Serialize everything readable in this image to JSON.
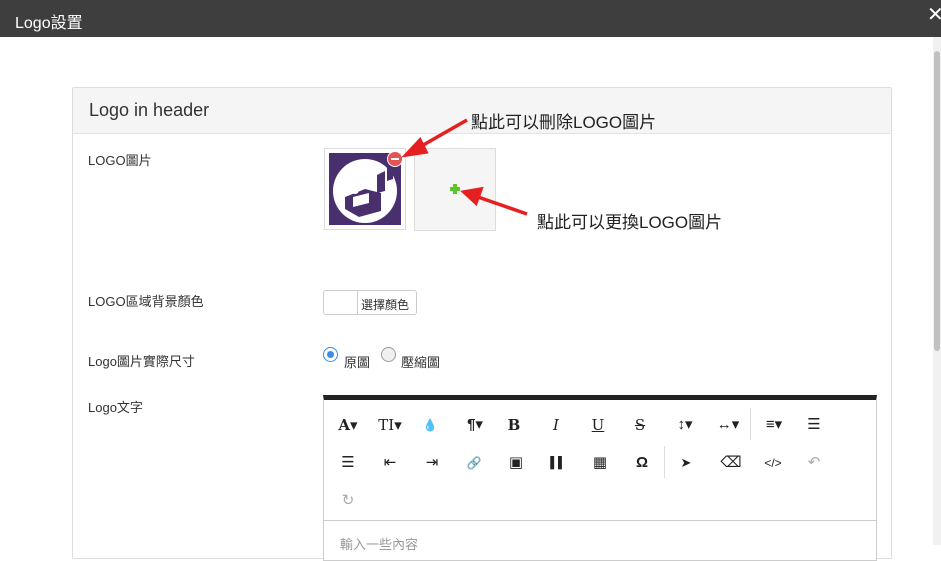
{
  "window": {
    "title": "Logo設置",
    "close_symbol": "✕"
  },
  "panel": {
    "heading": "Logo in header"
  },
  "fields": {
    "logo_image_label": "LOGO圖片",
    "bg_color_label": "LOGO區域背景顏色",
    "size_label": "Logo圖片實際尺寸",
    "text_label": "Logo文字"
  },
  "annotations": {
    "remove": "點此可以刪除LOGO圖片",
    "replace": "點此可以更換LOGO圖片"
  },
  "color_picker": {
    "button_label": "選擇顏色"
  },
  "size_options": [
    {
      "label": "原圖",
      "selected": true
    },
    {
      "label": "壓縮圖",
      "selected": false
    }
  ],
  "editor": {
    "placeholder": "輸入一些內容",
    "toolbar": [
      {
        "name": "font-style",
        "glyph": "A▾"
      },
      {
        "name": "font-size",
        "glyph": "TI▾"
      },
      {
        "name": "color",
        "glyph": "💧"
      },
      {
        "name": "paragraph",
        "glyph": "¶▾"
      },
      {
        "name": "bold",
        "glyph": "B"
      },
      {
        "name": "italic",
        "glyph": "I"
      },
      {
        "name": "underline",
        "glyph": "U"
      },
      {
        "name": "strikethrough",
        "glyph": "S"
      },
      {
        "name": "line-height",
        "glyph": "↕▾"
      },
      {
        "name": "letter-spacing",
        "glyph": "↔▾"
      },
      {
        "name": "align",
        "glyph": "≡▾"
      },
      {
        "name": "ordered-list",
        "glyph": "☰"
      },
      {
        "name": "unordered-list",
        "glyph": "☰"
      },
      {
        "name": "outdent",
        "glyph": "⇤"
      },
      {
        "name": "indent",
        "glyph": "⇥"
      },
      {
        "name": "link",
        "glyph": "🔗"
      },
      {
        "name": "image",
        "glyph": "▣"
      },
      {
        "name": "video",
        "glyph": "▌▌"
      },
      {
        "name": "table",
        "glyph": "▦"
      },
      {
        "name": "special-char",
        "glyph": "Ω"
      },
      {
        "name": "select",
        "glyph": "➤"
      },
      {
        "name": "eraser",
        "glyph": "⌫"
      },
      {
        "name": "code-view",
        "glyph": "</>"
      },
      {
        "name": "undo",
        "glyph": "↶"
      },
      {
        "name": "redo",
        "glyph": "↻"
      }
    ]
  },
  "colors": {
    "titlebar": "#3e3e3e",
    "logo_bg": "#4a2f6e",
    "remove": "#e45454",
    "add": "#5ac62a",
    "arrow": "#e62020",
    "radio_on": "#3d8be6"
  }
}
